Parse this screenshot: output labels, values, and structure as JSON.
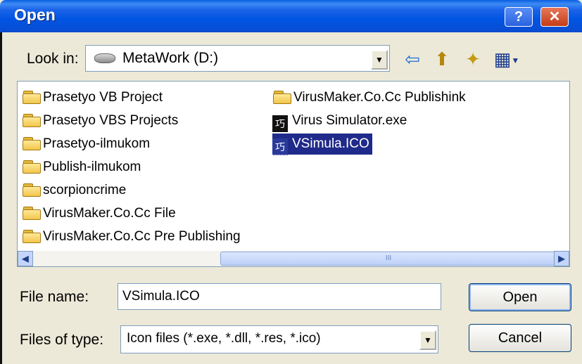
{
  "window": {
    "title": "Open",
    "help_glyph": "?",
    "close_glyph": "✕"
  },
  "look_in": {
    "label": "Look in:",
    "value": "MetaWork (D:)"
  },
  "toolbar": {
    "back_glyph": "⇦",
    "up_glyph": "⬆",
    "newfolder_glyph": "✦",
    "views_glyph": "▦"
  },
  "files": {
    "column1": [
      {
        "name": "Prasetyo VB Project",
        "icon": "folder-icon"
      },
      {
        "name": "Prasetyo VBS Projects",
        "icon": "folder-icon"
      },
      {
        "name": "Prasetyo-ilmukom",
        "icon": "folder-icon"
      },
      {
        "name": "Publish-ilmukom",
        "icon": "folder-icon"
      },
      {
        "name": "scorpioncrime",
        "icon": "folder-icon"
      },
      {
        "name": "VirusMaker.Co.Cc File",
        "icon": "folder-icon"
      },
      {
        "name": "VirusMaker.Co.Cc Pre Publishing",
        "icon": "folder-icon"
      }
    ],
    "column2": [
      {
        "name": "VirusMaker.Co.Cc Publishink",
        "icon": "folder-icon"
      },
      {
        "name": "Virus Simulator.exe",
        "icon": "exe-icon",
        "glyph": "巧"
      },
      {
        "name": "VSimula.ICO",
        "icon": "ico-file-icon",
        "glyph": "巧",
        "selected": true
      }
    ]
  },
  "scrollbar": {
    "left_glyph": "◀",
    "right_glyph": "▶",
    "grip": "III"
  },
  "file_name": {
    "label": "File name:",
    "value": "VSimula.ICO"
  },
  "file_type": {
    "label": "Files of type:",
    "value": "Icon files (*.exe, *.dll, *.res, *.ico)"
  },
  "buttons": {
    "open": "Open",
    "cancel": "Cancel"
  },
  "colors": {
    "titlebar": "#0054e3",
    "selection": "#1f2a8a",
    "dialog_bg": "#ece9d8"
  }
}
